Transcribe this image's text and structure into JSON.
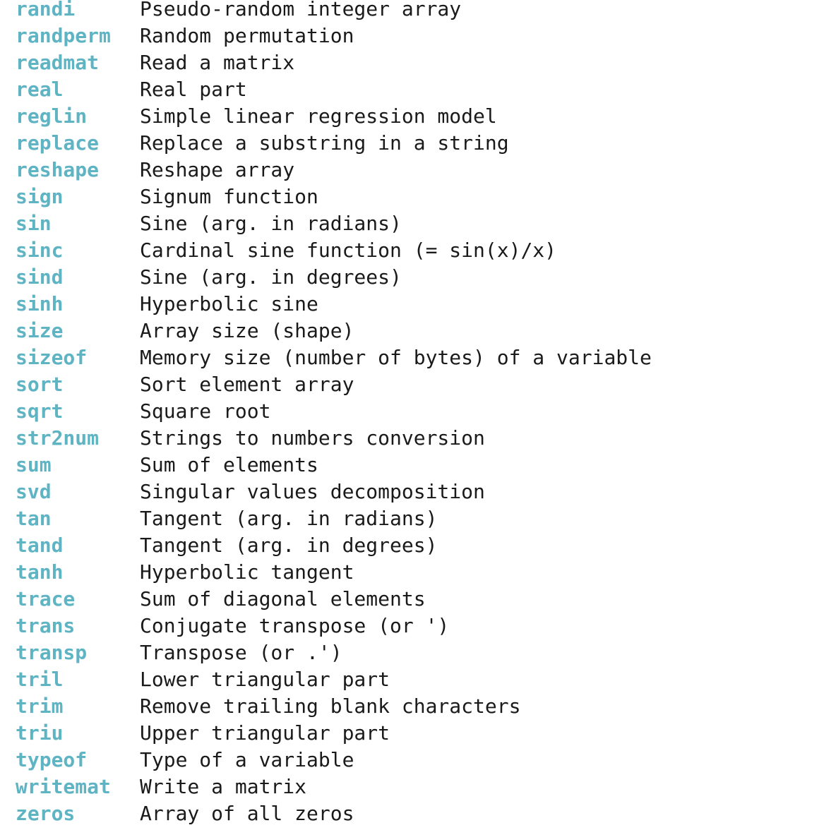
{
  "theme": {
    "name_color": "#5fb4c4",
    "desc_color": "#1a1a1a",
    "background": "#ffffff"
  },
  "functions": [
    {
      "name": "randi",
      "desc": "Pseudo-random integer array"
    },
    {
      "name": "randperm",
      "desc": "Random permutation"
    },
    {
      "name": "readmat",
      "desc": "Read a matrix"
    },
    {
      "name": "real",
      "desc": "Real part"
    },
    {
      "name": "reglin",
      "desc": "Simple linear regression model"
    },
    {
      "name": "replace",
      "desc": "Replace a substring in a string"
    },
    {
      "name": "reshape",
      "desc": "Reshape array"
    },
    {
      "name": "sign",
      "desc": "Signum function"
    },
    {
      "name": "sin",
      "desc": "Sine (arg. in radians)"
    },
    {
      "name": "sinc",
      "desc": "Cardinal sine function (= sin(x)/x)"
    },
    {
      "name": "sind",
      "desc": "Sine (arg. in degrees)"
    },
    {
      "name": "sinh",
      "desc": "Hyperbolic sine"
    },
    {
      "name": "size",
      "desc": "Array size (shape)"
    },
    {
      "name": "sizeof",
      "desc": "Memory size (number of bytes) of a variable"
    },
    {
      "name": "sort",
      "desc": "Sort element array"
    },
    {
      "name": "sqrt",
      "desc": "Square root"
    },
    {
      "name": "str2num",
      "desc": "Strings to numbers conversion"
    },
    {
      "name": "sum",
      "desc": "Sum of elements"
    },
    {
      "name": "svd",
      "desc": "Singular values decomposition"
    },
    {
      "name": "tan",
      "desc": "Tangent (arg. in radians)"
    },
    {
      "name": "tand",
      "desc": "Tangent (arg. in degrees)"
    },
    {
      "name": "tanh",
      "desc": "Hyperbolic tangent"
    },
    {
      "name": "trace",
      "desc": "Sum of diagonal elements"
    },
    {
      "name": "trans",
      "desc": "Conjugate transpose (or ')"
    },
    {
      "name": "transp",
      "desc": "Transpose (or .')"
    },
    {
      "name": "tril",
      "desc": "Lower triangular part"
    },
    {
      "name": "trim",
      "desc": "Remove trailing blank characters"
    },
    {
      "name": "triu",
      "desc": "Upper triangular part"
    },
    {
      "name": "typeof",
      "desc": "Type of a variable"
    },
    {
      "name": "writemat",
      "desc": "Write a matrix"
    },
    {
      "name": "zeros",
      "desc": "Array of all zeros"
    }
  ]
}
